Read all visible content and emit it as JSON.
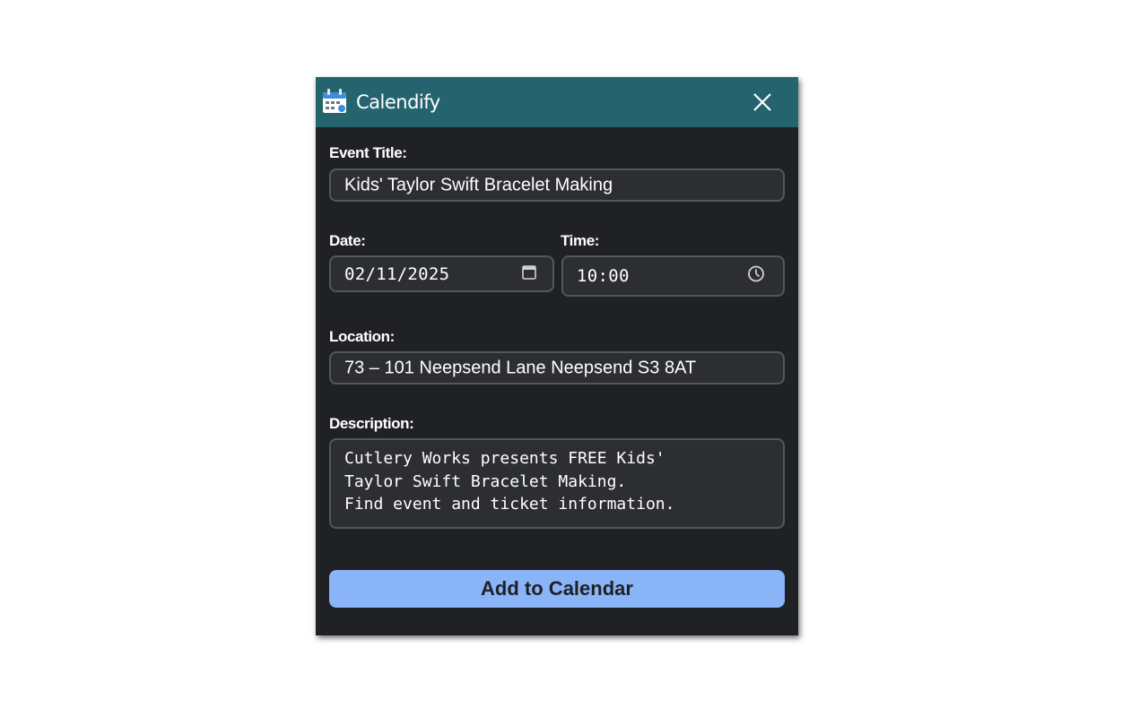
{
  "window": {
    "title": "Calendify",
    "icon": "calendar-icon",
    "close_icon": "close-icon"
  },
  "form": {
    "title_label": "Event Title:",
    "title_value": "Kids' Taylor Swift Bracelet Making",
    "date_label": "Date:",
    "date_value": "02/11/2025",
    "date_icon": "calendar-picker-icon",
    "time_label": "Time:",
    "time_value": "10:00",
    "time_icon": "clock-icon",
    "location_label": "Location:",
    "location_value": "73 – 101 Neepsend Lane Neepsend S3 8AT",
    "description_label": "Description:",
    "description_value": "Cutlery Works presents FREE Kids'\nTaylor Swift Bracelet Making.\nFind event and ticket information.",
    "submit_label": "Add to Calendar"
  },
  "colors": {
    "titlebar": "#25646e",
    "background": "#1f2124",
    "field_background": "#2c2e31",
    "field_border": "#54575b",
    "button": "#8ab4f8",
    "button_text": "#202124"
  }
}
